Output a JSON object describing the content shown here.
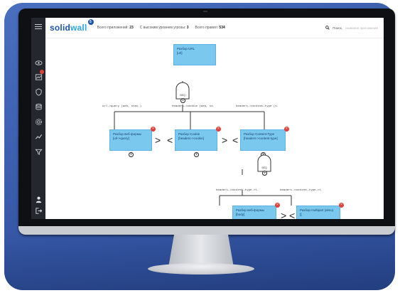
{
  "header": {
    "logo_part1": "solid",
    "logo_part2": "wall",
    "logo_badge": "5",
    "stat1_label": "Всего приложений:",
    "stat1_value": "23",
    "stat2_label": "С высоким уровнем угрозы:",
    "stat2_value": "3",
    "stat3_label": "Всего правил:",
    "stat3_value": "534",
    "search_label": "Поиск,",
    "search_placeholder": "названия приложения"
  },
  "sidebar": {
    "items": [
      "menu-icon",
      "eye-icon",
      "chart-icon",
      "shield-icon",
      "database-icon",
      "settings-icon",
      "analytics-icon",
      "filter-icon",
      "user-icon",
      "logout-icon"
    ]
  },
  "diagram": {
    "root": {
      "title": "Разбор URL",
      "sub": "[url]"
    },
    "gate_label": "SEQ",
    "edge_labels": {
      "e1": "url->query (web, ssec.)",
      "e2": "headers->cookie (web, ss.",
      "e3": "headers->content-type (s.",
      "e4": "headers->content-type->t.",
      "e5": "headers->content-type->t."
    },
    "nodes": {
      "n1": {
        "title": "Разбор веб-формы",
        "sub": "[url->query]"
      },
      "n2": {
        "title": "Разбор Cookie",
        "sub": "[headers->cookie]"
      },
      "n3": {
        "title": "Разбор Content-Type",
        "sub": "[headers->content-type]"
      },
      "n4": {
        "title": "Разбор веб-формы",
        "sub": "[body]"
      },
      "n5": {
        "title": "Разбор multipart (almo)",
        "sub": "[]"
      }
    },
    "symbols": {
      "delete": "×",
      "add": "+",
      "chevron": "<",
      "chevron_right": ">"
    }
  },
  "colors": {
    "node_fill": "#7bc8ef",
    "brand_dark": "#1f56a8",
    "brand_light": "#2ea8e0",
    "danger": "#e0403a",
    "sidebar": "#24272d"
  }
}
